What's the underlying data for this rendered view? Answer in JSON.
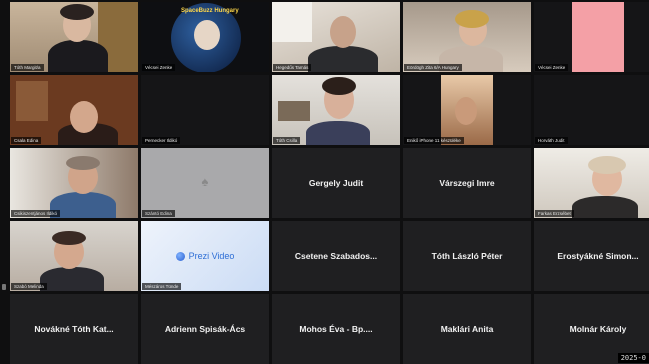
{
  "meeting": {
    "clock_text": "2025-0",
    "prezi_label": "Prezi Video",
    "logo_text": "SpaceBuzz Hungary"
  },
  "tiles": {
    "r0c0": "Tóth Margit/a",
    "r0c1": "Vécsei Zenke",
    "r0c2": "Hegedűs Tamás",
    "r0c3": "Eördögh Zita 6/A Hungary",
    "r0c4": "Vécsei Zenke",
    "r1c0": "Csala Edina",
    "r1c1": "Pernecker Ildikó",
    "r1c2": "Tóth Csilla",
    "r1c3": "Enikő iPhone 11 készüléke",
    "r1c4": "Horváth Judit",
    "r2c0": "Csikiszentjános Ildikó",
    "r2c1": "Szántó Edina",
    "r2c2": "Gergely Judit",
    "r2c3": "Várszegi Imre",
    "r2c4": "Farkas Erzsébet",
    "r3c0": "Szabó Melinda",
    "r3c1": "Mészáros Tünde",
    "r3c2": "Csetene Szabados...",
    "r3c3": "Tóth László Péter",
    "r3c4": "Erostyákné Simon...",
    "r4c0": "Novákné Tóth Kat...",
    "r4c1": "Adrienn Spisák-Ács",
    "r4c2": "Mohos Éva - Bp....",
    "r4c3": "Maklári Anita",
    "r4c4": "Molnár Károly"
  },
  "colors": {
    "background": "#0f0f10",
    "tile": "#1f1f21",
    "name_text": "#f2f2f2",
    "prezi_blue": "#2f6fd6"
  }
}
